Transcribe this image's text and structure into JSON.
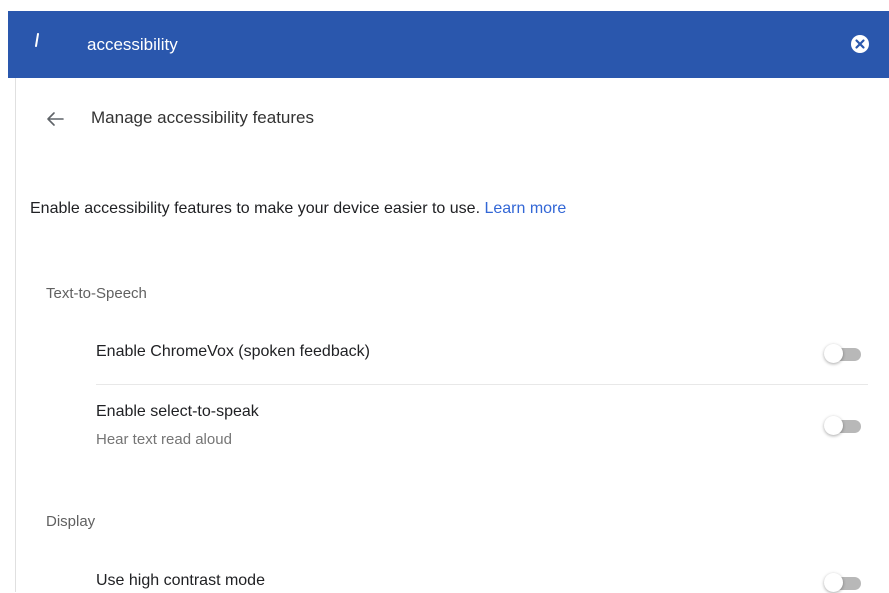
{
  "search": {
    "query": "accessibility",
    "icon": "search-caret-icon",
    "clear_icon": "clear-circle-x-icon"
  },
  "header": {
    "back_icon": "arrow-left-icon",
    "title": "Manage accessibility features"
  },
  "intro": {
    "text": "Enable accessibility features to make your device easier to use. ",
    "link": "Learn more"
  },
  "sections": {
    "tts": {
      "title": "Text-to-Speech",
      "items": [
        {
          "label": "Enable ChromeVox (spoken feedback)",
          "enabled": false
        },
        {
          "label": "Enable select-to-speak",
          "sublabel": "Hear text read aloud",
          "enabled": false
        }
      ]
    },
    "display": {
      "title": "Display",
      "items": [
        {
          "label": "Use high contrast mode",
          "enabled": false
        }
      ]
    }
  },
  "colors": {
    "search_bar": "#2a57ad",
    "link": "#3367d6",
    "toggle_track_off": "#b8b8b8"
  }
}
